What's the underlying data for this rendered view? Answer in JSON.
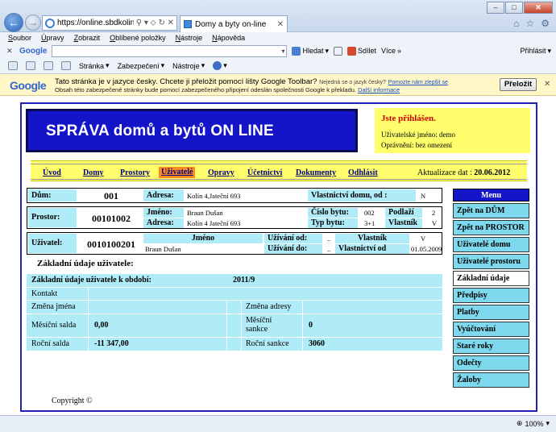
{
  "browser": {
    "url": "https://online.sbdkolin.cz/",
    "tab_title": "Domy a byty on-line",
    "menu": [
      "Soubor",
      "Úpravy",
      "Zobrazit",
      "Oblíbené položky",
      "Nástroje",
      "Nápověda"
    ],
    "google_toolbar": {
      "logo": "Google",
      "search_label": "Hledat",
      "share_label": "Sdílet",
      "more_label": "Více",
      "sign_in": "Přihlásit"
    },
    "command_bar": [
      "Stránka",
      "Zabezpečení",
      "Nástroje"
    ],
    "translate_bar": {
      "logo": "Google",
      "message": "Tato stránka je v jazyce česky. Chcete ji přeložit pomocí lišty Google Toolbar?",
      "not_czech": "Nejedná se o jazyk česky?",
      "help_link": "Pomozte nám zlepšit se",
      "sub_message": "Obsah této zabezpečené stránky bude pomocí zabezpečeného připojení odeslán společnosti Google k překladu.",
      "more_info": "Další informace",
      "translate_button": "Přeložit"
    },
    "zoom": "100%"
  },
  "header": {
    "title": "SPRÁVA domů a bytů ON LINE",
    "login_status": "Jste přihlášen.",
    "username_line": "Uživatelské jméno: demo",
    "permission_line": "Oprávnění: bez omezení"
  },
  "nav": {
    "links": [
      "Úvod",
      "Domy",
      "Prostory",
      "Uživatelé",
      "Opravy",
      "Účetnictví",
      "Dokumenty",
      "Odhlásit"
    ],
    "active": "Uživatelé",
    "update_label": "Aktualizace dat : ",
    "update_date": "20.06.2012"
  },
  "dum": {
    "label": "Dům:",
    "number": "001",
    "address_label": "Adresa:",
    "address": "Kolín 4,Jateční 693",
    "ownership_label": "Vlastnictví domu, od :",
    "ownership_value": "N"
  },
  "prostor": {
    "label": "Prostor:",
    "number": "00101002",
    "name_label": "Jméno:",
    "name": "Braun Dušan",
    "address_label": "Adresa:",
    "address": "Kolín 4 Jateční 693",
    "unit_no_label": "Číslo bytu:",
    "unit_no": "002",
    "floor_label": "Podlaží",
    "floor": "2",
    "type_label": "Typ bytu:",
    "type": "3+1",
    "owner_label": "Vlastník",
    "owner": "V"
  },
  "uzivatel": {
    "label": "Uživatel:",
    "number": "0010100201",
    "name_header": "Jméno",
    "name": "Braun Dušan",
    "use_from_label": "Užívání od:",
    "use_from": "..",
    "use_to_label": "Užívání do:",
    "use_to": "..",
    "owner_header": "Vlastník",
    "owner": "V",
    "ownership_from_label": "Vlastnictví od",
    "ownership_from": "01.05.2009"
  },
  "basic": {
    "subtitle": "Základní údaje uživatele:",
    "period_label": "Základní údaje uživatele k období:",
    "period": "2011/9",
    "contact_label": "Kontakt",
    "name_change_label": "Změna jména",
    "address_change_label": "Změna adresy",
    "monthly_balance_label": "Měsíční salda",
    "monthly_balance": "0,00",
    "monthly_sanction_label_1": "Měsíční",
    "monthly_sanction_label_2": "sankce",
    "monthly_sanction": "0",
    "annual_balance_label": "Roční salda",
    "annual_balance": "-11 347,00",
    "annual_sanction_label": "Roční sankce",
    "annual_sanction": "3060"
  },
  "sidebar": {
    "title": "Menu",
    "items": [
      "Zpět na DŮM",
      "Zpět na PROSTOR",
      "Uživatelé domu",
      "Uživatelé prostoru",
      "Základní údaje",
      "Předpisy",
      "Platby",
      "Vyúčtování",
      "Staré roky",
      "Odečty",
      "Žaloby"
    ],
    "active": "Základní údaje"
  },
  "footer": {
    "copyright": "Copyright ©"
  }
}
